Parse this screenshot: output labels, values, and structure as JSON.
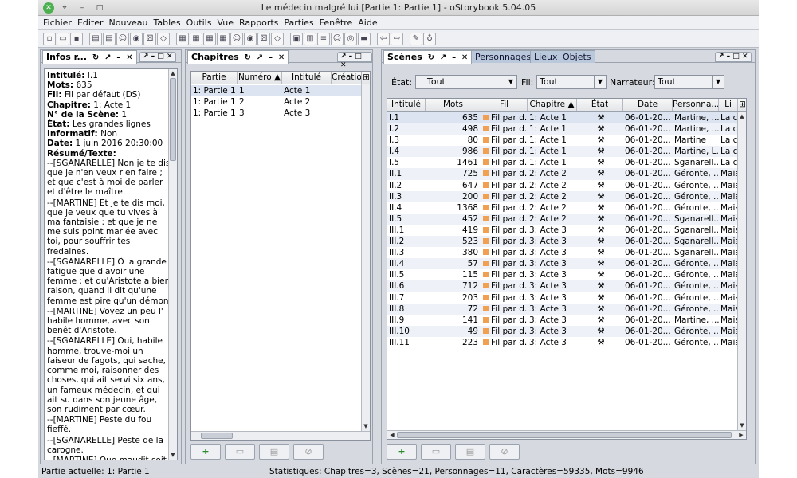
{
  "window": {
    "title": "Le médecin malgré lui [Partie 1: Partie 1] - oStorybook 5.04.05"
  },
  "menu": [
    "Fichier",
    "Editer",
    "Nouveau",
    "Tables",
    "Outils",
    "Vue",
    "Rapports",
    "Parties",
    "Fenêtre",
    "Aide"
  ],
  "toolbar_icons": [
    "new-file-icon",
    "open-folder-icon",
    "save-icon",
    "document-icon",
    "document-icon",
    "person-icon",
    "globe-icon",
    "dice-icon",
    "tag-icon",
    "table-icon",
    "table-icon",
    "table-icon",
    "table-icon",
    "person-icon",
    "globe-icon",
    "dice-icon",
    "tag-icon",
    "calendar-icon",
    "book-icon",
    "list-icon",
    "person-icon",
    "spiral-icon",
    "chest-icon",
    "arrow-left-icon",
    "arrow-right-icon",
    "pen-icon",
    "bulb-icon"
  ],
  "info": {
    "tab": "Infos r...",
    "intitule_label": "Intitulé:",
    "intitule": "I.1",
    "mots_label": "Mots:",
    "mots": "635",
    "fil_label": "Fil:",
    "fil": "Fil par défaut (DS)",
    "chapitre_label": "Chapitre:",
    "chapitre": "1: Acte 1",
    "scene_label": "N° de la Scène:",
    "scene": "1",
    "etat_label": "État:",
    "etat": "Les grandes lignes",
    "informatif_label": "Informatif:",
    "informatif": "Non",
    "date_label": "Date:",
    "date": "1 juin 2016 20:30:00",
    "resume_label": "Résumé/Texte:",
    "texte": [
      "--[SGANARELLE] Non je te dis que je n'en veux rien faire ; et que c'est à moi de parler et d'être le maître.",
      "--[MARTINE] Et je te dis moi, que je veux que tu vives à ma fantaisie : et que je ne me suis point mariée avec toi, pour souffrir tes fredaines.",
      "--[SGANARELLE] Ô la grande fatigue que d'avoir une femme : et qu'Aristote a bien raison, quand il dit qu'une femme est pire qu'un démon!",
      "--[MARTINE] Voyez un peu l' habile homme, avec son benêt d'Aristote.",
      "--[SGANARELLE] Oui, habile homme, trouve-moi un faiseur de fagots, qui sache, comme moi, raisonner des choses, qui ait servi six ans, un fameux médecin, et qui ait su dans son jeune âge, son rudiment par cœur.",
      "--[MARTINE] Peste du fou fieffé.",
      "--[SGANARELLE] Peste de la carogne.",
      "--[MARTINE] Que maudit soit l' heure et le jour, où je m' avisai d'aller dire oui"
    ]
  },
  "chapitres": {
    "tab": "Chapitres",
    "columns": [
      "Partie",
      "Numéro ▲",
      "Intitulé",
      "Création"
    ],
    "rows": [
      [
        "1: Partie 1",
        "1",
        "Acte 1"
      ],
      [
        "1: Partie 1",
        "2",
        "Acte 2"
      ],
      [
        "1: Partie 1",
        "3",
        "Acte 3"
      ]
    ]
  },
  "scenes": {
    "tabs": [
      "Scènes",
      "Personnages",
      "Lieux",
      "Objets"
    ],
    "filter_etat_label": "État:",
    "filter_etat": "Tout",
    "filter_fil_label": "Fil:",
    "filter_fil": "Tout",
    "filter_narrateur_label": "Narrateur:",
    "filter_narrateur": "Tout",
    "columns": [
      "Intitulé",
      "Mots",
      "Fil",
      "Chapitre ▲",
      "État",
      "Date",
      "Personna...",
      "Li"
    ],
    "rows": [
      [
        "I.1",
        "635",
        "Fil par d...",
        "1: Acte 1",
        "06-01-20...",
        "Martine, ...",
        "La c"
      ],
      [
        "I.2",
        "498",
        "Fil par d...",
        "1: Acte 1",
        "06-01-20...",
        "Martine, ...",
        "La c"
      ],
      [
        "I.3",
        "80",
        "Fil par d...",
        "1: Acte 1",
        "06-01-20...",
        "Martine",
        "La c"
      ],
      [
        "I.4",
        "986",
        "Fil par d...",
        "1: Acte 1",
        "06-01-20...",
        "Martine, L...",
        "La c"
      ],
      [
        "I.5",
        "1461",
        "Fil par d...",
        "1: Acte 1",
        "06-01-20...",
        "Sganarell...",
        "La c"
      ],
      [
        "II.1",
        "725",
        "Fil par d...",
        "2: Acte 2",
        "06-01-20...",
        "Géronte, ...",
        "Mais"
      ],
      [
        "II.2",
        "647",
        "Fil par d...",
        "2: Acte 2",
        "06-01-20...",
        "Géronte, ...",
        "Mais"
      ],
      [
        "II.3",
        "200",
        "Fil par d...",
        "2: Acte 2",
        "06-01-20...",
        "Géronte, ...",
        "Mais"
      ],
      [
        "II.4",
        "1368",
        "Fil par d...",
        "2: Acte 2",
        "06-01-20...",
        "Géronte, ...",
        "Mais"
      ],
      [
        "II.5",
        "452",
        "Fil par d...",
        "2: Acte 2",
        "06-01-20...",
        "Sganarell...",
        "Mais"
      ],
      [
        "III.1",
        "419",
        "Fil par d...",
        "3: Acte 3",
        "06-01-20...",
        "Sganarell...",
        "Mais"
      ],
      [
        "III.2",
        "523",
        "Fil par d...",
        "3: Acte 3",
        "06-01-20...",
        "Sganarell...",
        "Mais"
      ],
      [
        "III.3",
        "380",
        "Fil par d...",
        "3: Acte 3",
        "06-01-20...",
        "Sganarell...",
        "Mais"
      ],
      [
        "III.4",
        "57",
        "Fil par d...",
        "3: Acte 3",
        "06-01-20...",
        "Géronte, ...",
        "Mais"
      ],
      [
        "III.5",
        "115",
        "Fil par d...",
        "3: Acte 3",
        "06-01-20...",
        "Géronte, ...",
        "Mais"
      ],
      [
        "III.6",
        "712",
        "Fil par d...",
        "3: Acte 3",
        "06-01-20...",
        "Géronte, ...",
        "Mais"
      ],
      [
        "III.7",
        "203",
        "Fil par d...",
        "3: Acte 3",
        "06-01-20...",
        "Géronte, ...",
        "Mais"
      ],
      [
        "III.8",
        "72",
        "Fil par d...",
        "3: Acte 3",
        "06-01-20...",
        "Géronte, ...",
        "Mais"
      ],
      [
        "III.9",
        "141",
        "Fil par d...",
        "3: Acte 3",
        "06-01-20...",
        "Martine, ...",
        "Mais"
      ],
      [
        "III.10",
        "49",
        "Fil par d...",
        "3: Acte 3",
        "06-01-20...",
        "Géronte, ...",
        "Mais"
      ],
      [
        "III.11",
        "223",
        "Fil par d...",
        "3: Acte 3",
        "06-01-20...",
        "Géronte, ...",
        "Mais"
      ]
    ]
  },
  "status": {
    "left": "Partie actuelle: 1: Partie 1",
    "right": "Statistiques: Chapitres=3,  Scènes=21,  Personnages=11,  Caractères=59335,  Mots=9946"
  },
  "colors": {
    "fil": "#f0a050",
    "tab_inactive": "#b9c8da",
    "row_alt": "#eef2f8"
  }
}
